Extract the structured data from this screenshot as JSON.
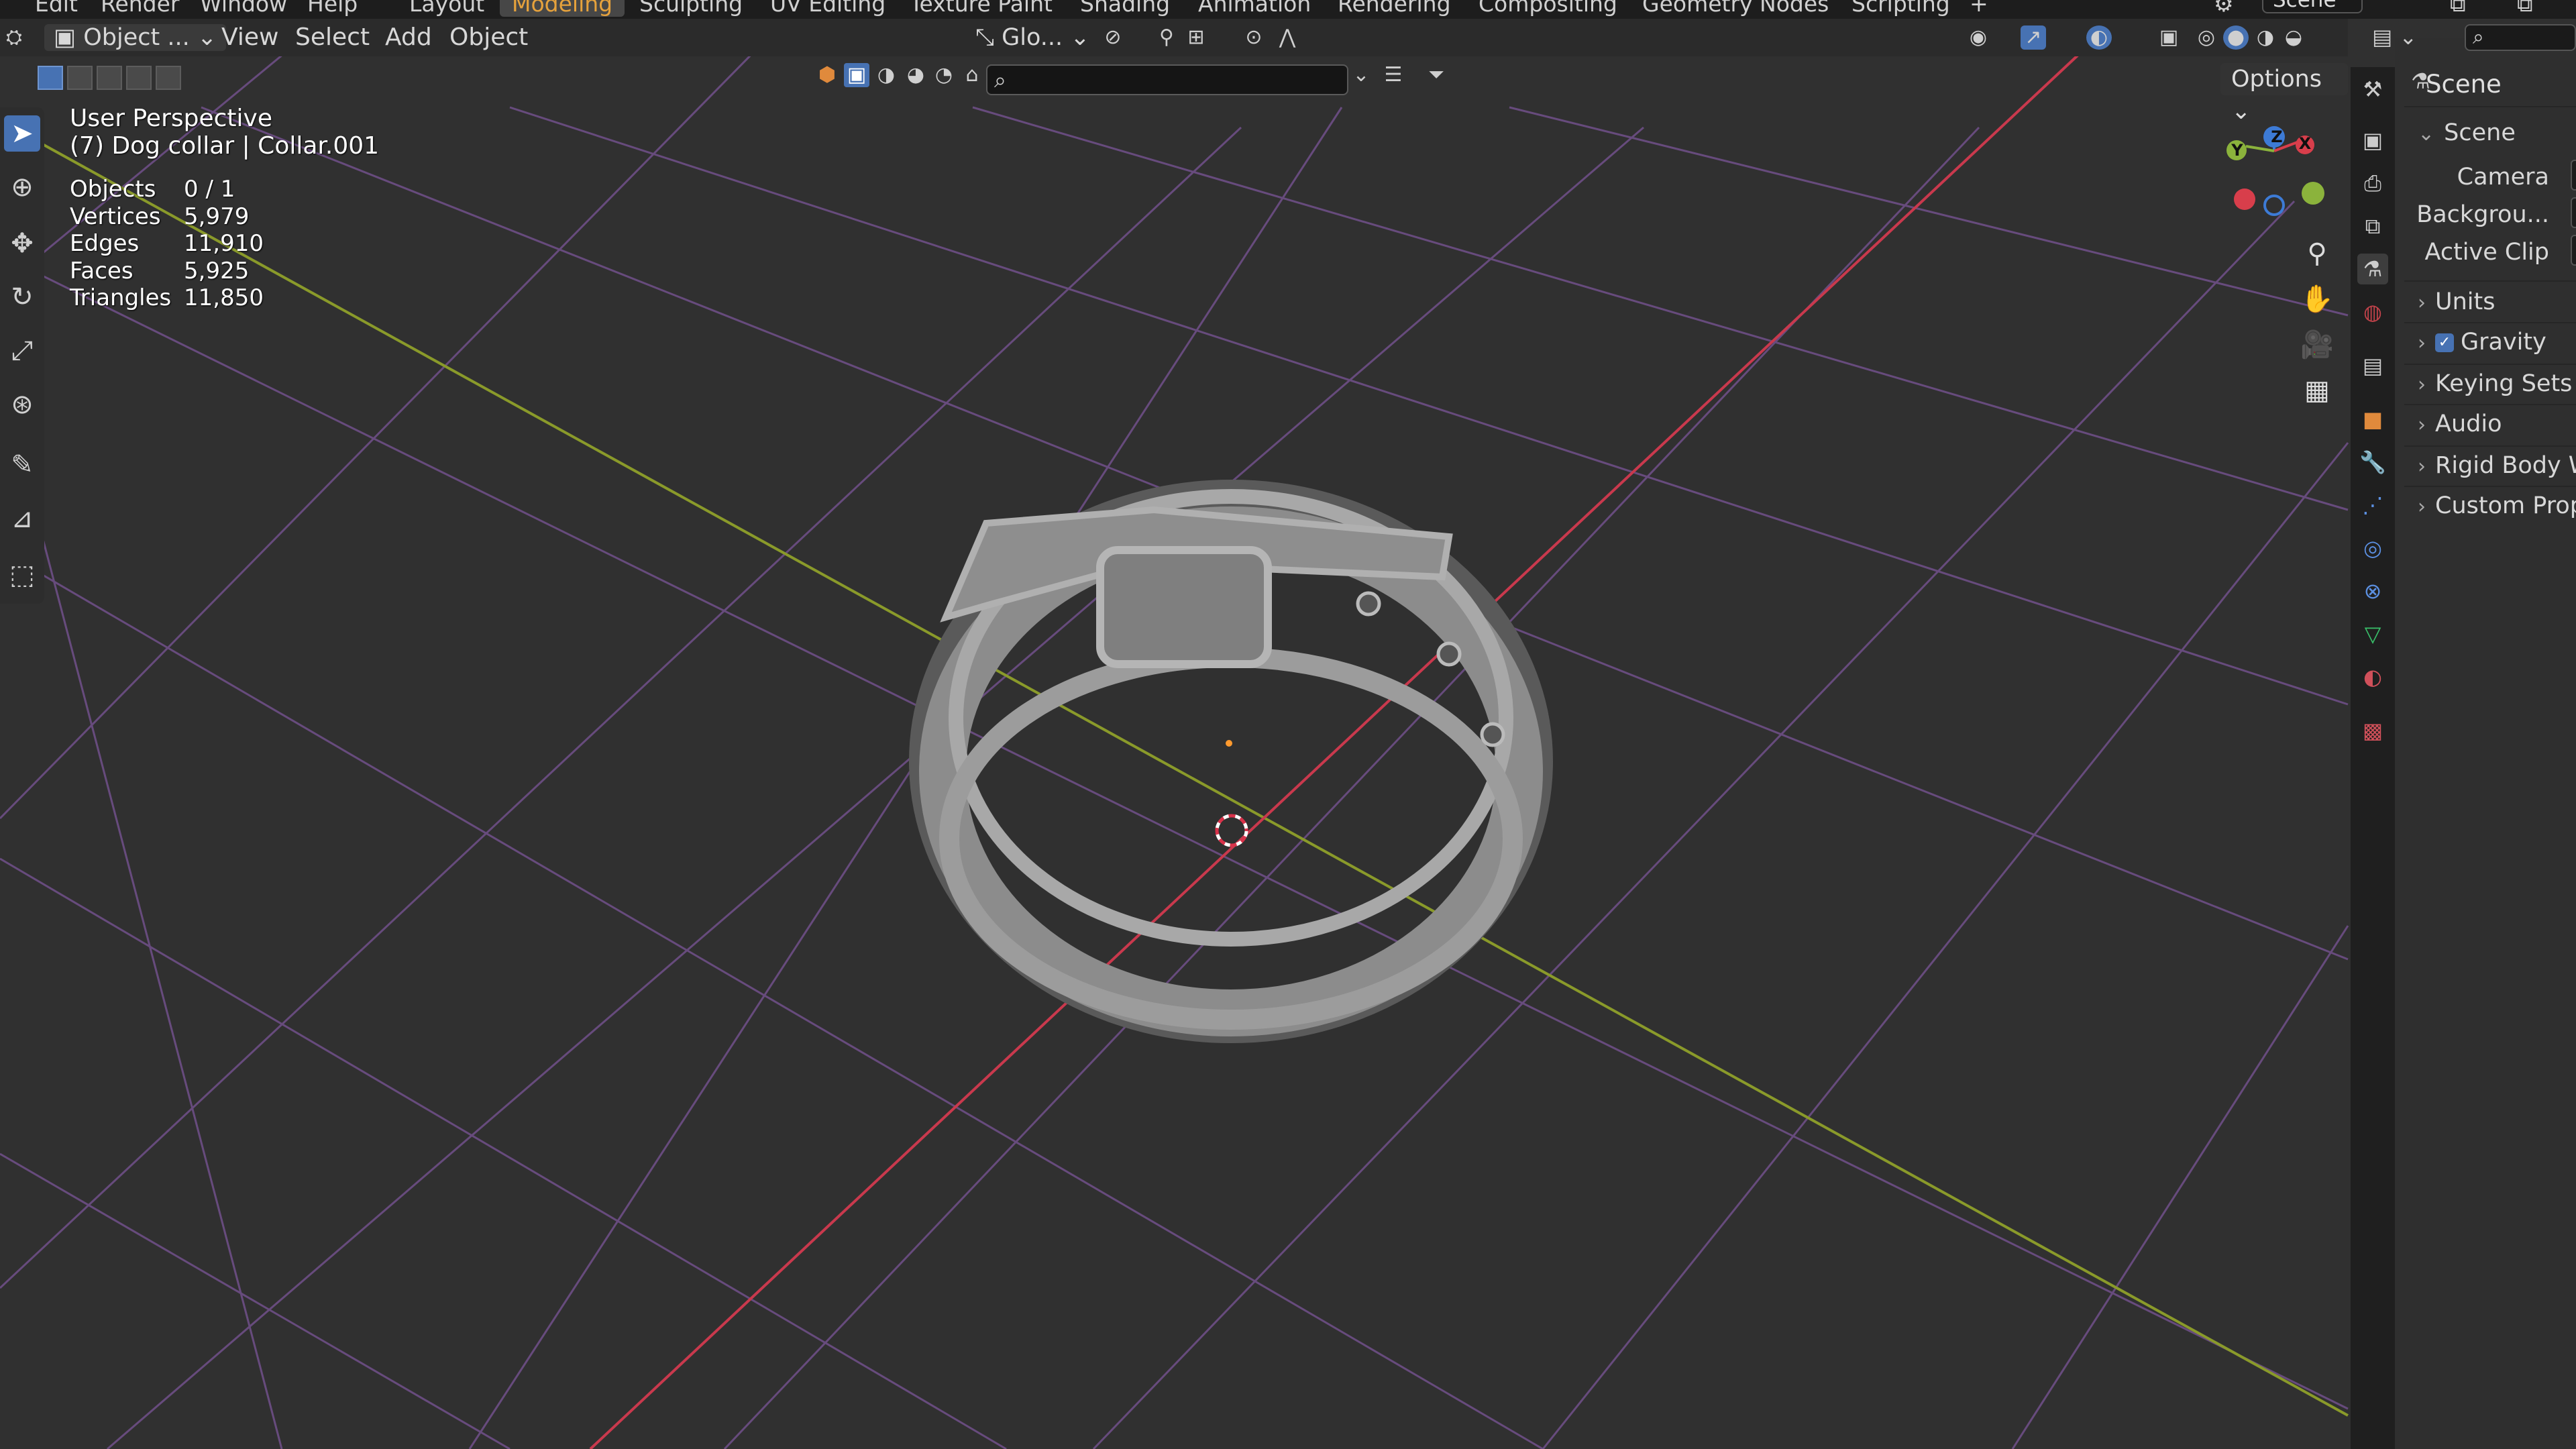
{
  "menu": {
    "items": [
      "Edit",
      "Render",
      "Window",
      "Help"
    ]
  },
  "workspaces": [
    {
      "label": "Layout",
      "active": false
    },
    {
      "label": "Modeling",
      "active": true
    },
    {
      "label": "Sculpting",
      "active": false
    },
    {
      "label": "UV Editing",
      "active": false
    },
    {
      "label": "Texture Paint",
      "active": false
    },
    {
      "label": "Shading",
      "active": false
    },
    {
      "label": "Animation",
      "active": false
    },
    {
      "label": "Rendering",
      "active": false
    },
    {
      "label": "Compositing",
      "active": false
    },
    {
      "label": "Geometry Nodes",
      "active": false
    },
    {
      "label": "Scripting",
      "active": false
    }
  ],
  "add_workspace": "+",
  "scene_search": {
    "value": "Scene"
  },
  "viewport_header": {
    "mode_label": "Object ...",
    "view": "View",
    "select": "Select",
    "add": "Add",
    "object": "Object",
    "transform_orientation": "Glo..."
  },
  "subbar": {
    "search_placeholder": "",
    "options_label": "Options"
  },
  "viewport": {
    "perspective_label": "User Perspective",
    "object_label": "(7) Dog collar | Collar.001",
    "stats": [
      {
        "label": "Objects",
        "value": "0 / 1"
      },
      {
        "label": "Vertices",
        "value": "5,979"
      },
      {
        "label": "Edges",
        "value": "11,910"
      },
      {
        "label": "Faces",
        "value": "5,925"
      },
      {
        "label": "Triangles",
        "value": "11,850"
      }
    ],
    "gizmo": {
      "x": "X",
      "y": "Y",
      "z": "Z"
    }
  },
  "properties": {
    "header_title": "Scene",
    "panel_title": "Scene",
    "fields": [
      {
        "label": "Camera"
      },
      {
        "label": "Backgrou..."
      },
      {
        "label": "Active Clip"
      }
    ],
    "sections": [
      {
        "label": "Units",
        "checked": false
      },
      {
        "label": "Gravity",
        "checked": true
      },
      {
        "label": "Keying Sets",
        "checked": false
      },
      {
        "label": "Audio",
        "checked": false
      },
      {
        "label": "Rigid Body W",
        "checked": false
      },
      {
        "label": "Custom Prop",
        "checked": false
      }
    ]
  },
  "colors": {
    "accent_active": "#4772b3",
    "workspace_active_text": "#e6a23c",
    "axis_x": "#c9394d",
    "axis_y": "#8a9a2a",
    "grid": "#7a5a8f"
  },
  "icons": [
    "search-icon",
    "filter-icon",
    "zoom-icon",
    "hand-pan-icon",
    "camera-icon",
    "grid-view-icon",
    "cursor-icon",
    "move-icon",
    "rotate-icon",
    "scale-icon",
    "transform-icon",
    "annotate-icon",
    "measure-icon",
    "add-cube-icon"
  ]
}
